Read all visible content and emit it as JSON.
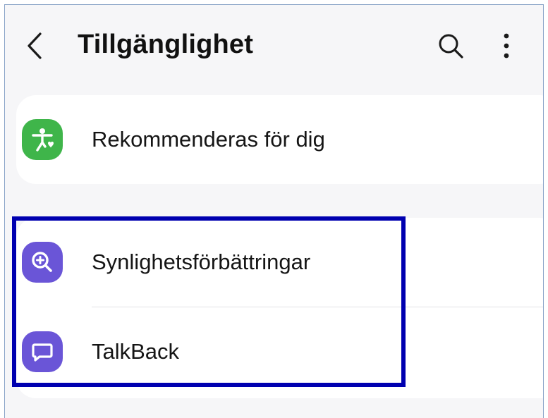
{
  "header": {
    "title": "Tillgänglighet",
    "back_icon": "chevron-left-icon",
    "search_icon": "search-icon",
    "more_icon": "more-vertical-icon"
  },
  "items": [
    {
      "label": "Rekommenderas för dig",
      "icon": "accessibility-heart-icon",
      "icon_color": "#3fb54a"
    },
    {
      "label": "Synlighetsförbättringar",
      "icon": "zoom-in-icon",
      "icon_color": "#6a55d7"
    },
    {
      "label": "TalkBack",
      "icon": "speech-bubble-icon",
      "icon_color": "#6a55d7"
    }
  ],
  "colors": {
    "background": "#f6f6f8",
    "card": "#ffffff",
    "highlight_border": "#0000b0"
  }
}
